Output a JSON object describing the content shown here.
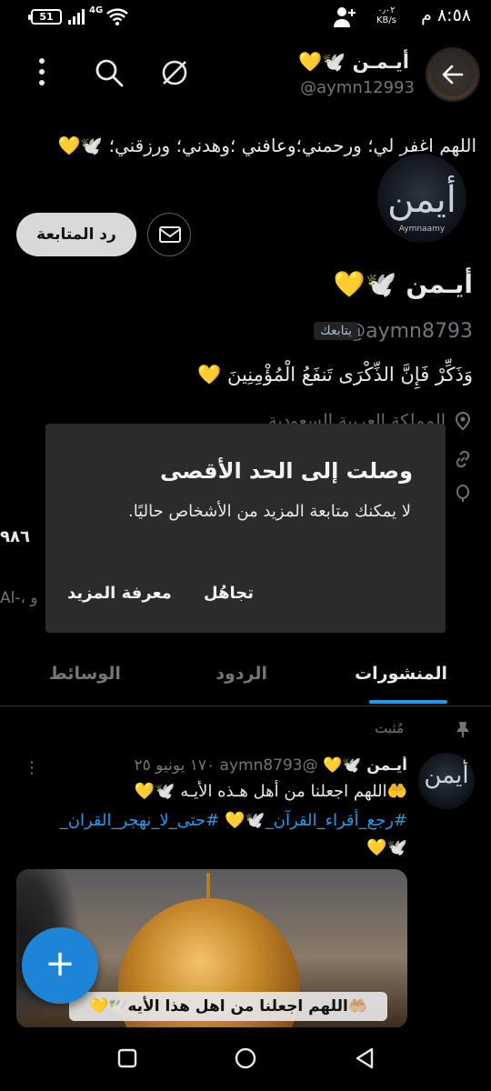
{
  "status_bar": {
    "time": "٨:٥٨ م",
    "data_speed_value": "٠٫٠٢",
    "data_speed_unit": "KB/s",
    "network": "4G",
    "battery": "51"
  },
  "header": {
    "display_name": "أيـمـن 🕊️💛",
    "handle": "@aymn12993"
  },
  "top_bio": "اللهم اغفر لي؛ ورحمني؛وعافني ؛وهدني؛ ورزقني؛ 🕊️💛",
  "profile": {
    "avatar_logo": "أيمن",
    "avatar_sub": "Aymnaamy",
    "follow_back_label": "رد المتابعة",
    "name": "أيـمن 🕊️💛",
    "handle": "@aymn8793",
    "follows_you": "يتابعك",
    "bio": "وَذَكِّرْ فَإِنَّ الذِّكْرَى تَنفَعُ الْمُؤْمِنِينَ 💛",
    "location": "المملكة العربية السعودية",
    "stat_peek": "٩٨٦",
    "peek_text": "Al-، و"
  },
  "dialog": {
    "title": "وصلت إلى الحد الأقصى",
    "body": "لا يمكنك متابعة المزيد من الأشخاص حاليًا.",
    "dismiss_label": "تجاهُل",
    "learn_more_label": "معرفة المزيد"
  },
  "tabs": {
    "posts": "المنشورات",
    "replies": "الردود",
    "media": "الوسائط"
  },
  "pinned_post": {
    "pinned_label": "مُثبت",
    "author": "أيـمن 🕊️💛",
    "handle": "@aymn8793",
    "date": "١٧٠ يونيو ٢٥",
    "line1": "🤲اللهم اجعلنا من أهل هـذه الأيـه 🕊️💛",
    "line2": "#رجع_أقراء_القرآن_🕊️💛 #حتى_لا_نهجر_القران_",
    "line3": "🕊️💛",
    "media_caption": "🤲🏼اللهم اجعلنا من اهل هذا الأيه🕊️💛"
  },
  "fab": {
    "label": "+"
  },
  "icons": [
    "back-arrow-icon",
    "grok-slash-icon",
    "search-icon",
    "more-vertical-icon",
    "mail-icon",
    "location-icon",
    "link-icon",
    "balloon-icon",
    "pin-icon",
    "nav-recents-icon",
    "nav-home-icon",
    "nav-back-icon"
  ],
  "colors": {
    "accent": "#1d9bf0",
    "background": "#000000",
    "dialog_bg": "#2b2b2b",
    "fab": "#1d84d6"
  }
}
